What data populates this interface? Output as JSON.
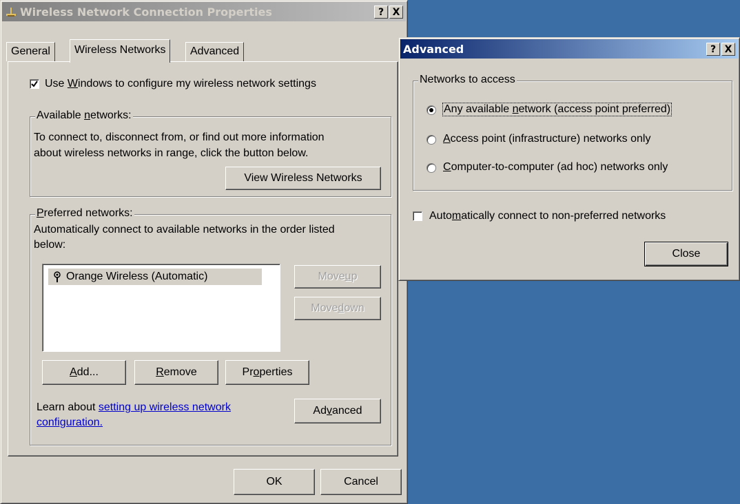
{
  "main_window": {
    "title": "Wireless Network Connection Properties",
    "help_btn": "?",
    "close_btn": "X",
    "tabs": [
      {
        "label": "General"
      },
      {
        "label": "Wireless Networks"
      },
      {
        "label": "Advanced"
      }
    ],
    "use_windows_checkbox": {
      "checked": true,
      "label_pre": "Use ",
      "label_u": "W",
      "label_post": "indows to configure my wireless network settings"
    },
    "available": {
      "group_pre": "Available ",
      "group_u": "n",
      "group_post": "etworks:",
      "desc1": "To connect to, disconnect from, or find out more information",
      "desc2": "about wireless networks in range, click the button below.",
      "view_button": "View Wireless Networks"
    },
    "preferred": {
      "group_u": "P",
      "group_post": "referred networks:",
      "desc1": "Automatically connect to available networks in the order listed",
      "desc2": "below:",
      "items": [
        {
          "label": "Orange Wireless (Automatic)"
        }
      ],
      "move_up_pre": "Move ",
      "move_up_u": "u",
      "move_up_post": "p",
      "move_down_pre": "Move ",
      "move_down_u": "d",
      "move_down_post": "own",
      "add_u": "A",
      "add_post": "dd...",
      "remove_u": "R",
      "remove_post": "emove",
      "properties_pre": "Pr",
      "properties_u": "o",
      "properties_post": "perties"
    },
    "learn_text": "Learn about ",
    "learn_link1": "setting up wireless network",
    "learn_link2": "configuration.",
    "advanced_pre": "Ad",
    "advanced_u": "v",
    "advanced_post": "anced",
    "ok_button": "OK",
    "cancel_button": "Cancel"
  },
  "advanced_dialog": {
    "title": "Advanced",
    "help_btn": "?",
    "close_btn": "X",
    "group_label": "Networks to access",
    "options": [
      {
        "pre": "Any available ",
        "u": "n",
        "post": "etwork (access point preferred)",
        "selected": true
      },
      {
        "pre": "",
        "u": "A",
        "post": "ccess point (infrastructure) networks only",
        "selected": false
      },
      {
        "pre": "",
        "u": "C",
        "post": "omputer-to-computer (ad hoc) networks only",
        "selected": false
      }
    ],
    "auto_connect": {
      "checked": false,
      "pre": "Auto",
      "u": "m",
      "post": "atically connect to non-preferred networks"
    },
    "close_button": "Close"
  }
}
